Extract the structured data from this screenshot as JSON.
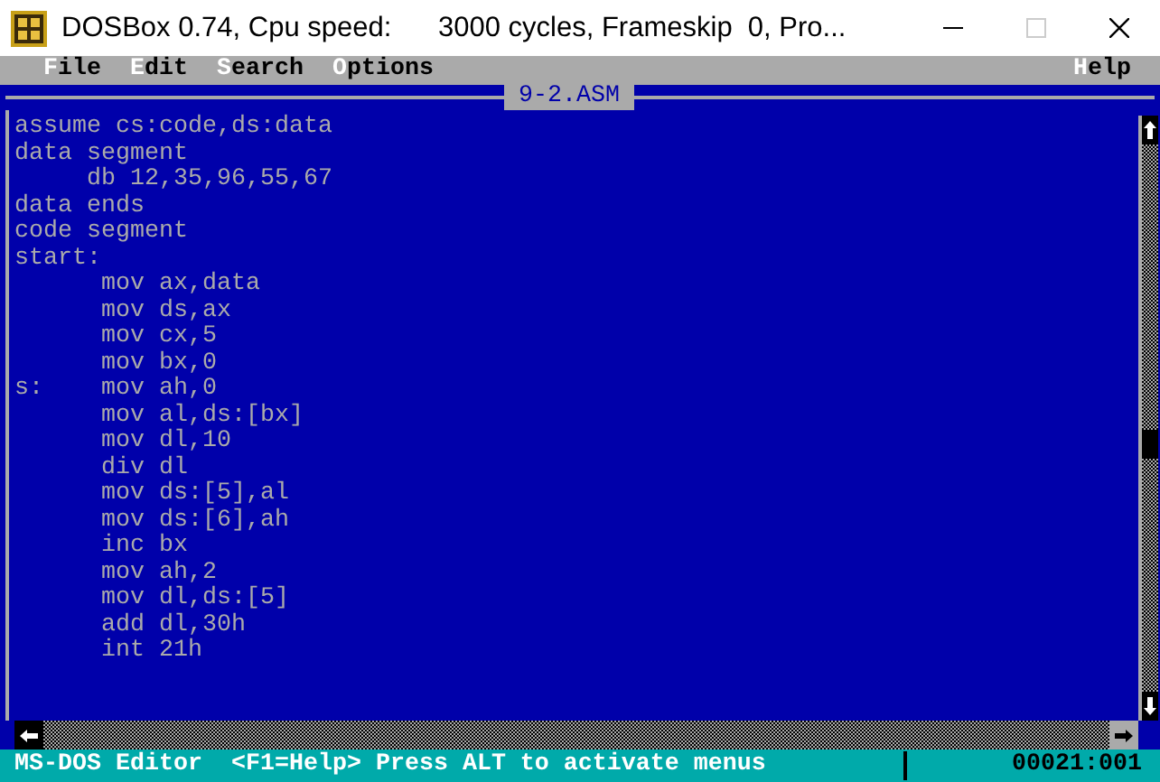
{
  "window": {
    "title": "DOSBox 0.74, Cpu speed:      3000 cycles, Frameskip  0, Pro..."
  },
  "menu": [
    {
      "label": "File"
    },
    {
      "label": "Edit"
    },
    {
      "label": "Search"
    },
    {
      "label": "Options"
    }
  ],
  "help_menu": {
    "label": "Help"
  },
  "editor": {
    "filename": "9-2.ASM",
    "lines": [
      "assume cs:code,ds:data",
      "data segment",
      "     db 12,35,96,55,67",
      "data ends",
      "code segment",
      "start:",
      "      mov ax,data",
      "      mov ds,ax",
      "      mov cx,5",
      "      mov bx,0",
      "s:    mov ah,0",
      "      mov al,ds:[bx]",
      "      mov dl,10",
      "      div dl",
      "      mov ds:[5],al",
      "      mov ds:[6],ah",
      "      inc bx",
      "      mov ah,2",
      "      mov dl,ds:[5]",
      "      add dl,30h",
      "      int 21h"
    ]
  },
  "status_bar": {
    "message": "MS-DOS Editor  <F1=Help> Press ALT to activate menus",
    "position": "00021:001"
  }
}
